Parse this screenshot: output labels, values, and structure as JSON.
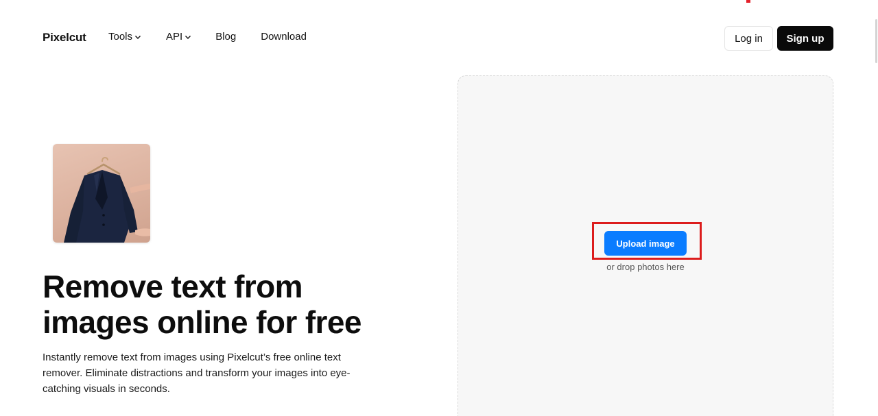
{
  "nav": {
    "logo": "Pixelcut",
    "links": [
      {
        "label": "Tools",
        "dropdown": true
      },
      {
        "label": "API",
        "dropdown": true
      },
      {
        "label": "Blog",
        "dropdown": false
      },
      {
        "label": "Download",
        "dropdown": false
      }
    ],
    "login_label": "Log in",
    "signup_label": "Sign up"
  },
  "hero": {
    "title_line1": "Remove text from",
    "title_line2": "images online for free",
    "description": "Instantly remove text from images using Pixelcut’s free online text remover. Eliminate distractions and transform your images into eye-catching visuals in seconds.",
    "thumbnail_icon": "jacket-on-hanger-image"
  },
  "upload": {
    "button_label": "Upload image",
    "hint": "or drop photos here"
  },
  "colors": {
    "accent": "#0a7cff",
    "highlight": "#dc1c1c",
    "signup_bg": "#0a0a0a",
    "dropzone_bg": "#f7f7f7"
  }
}
